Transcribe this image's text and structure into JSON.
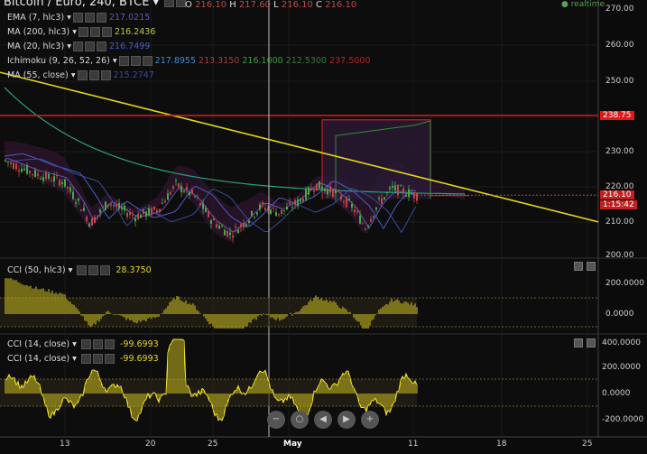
{
  "header": {
    "title": "Bitcoin / Euro, 240, BTCE",
    "ohlc": [
      {
        "k": "O",
        "v": "216.10"
      },
      {
        "k": "H",
        "v": "217.60"
      },
      {
        "k": "L",
        "v": "216.10"
      },
      {
        "k": "C",
        "v": "216.10"
      }
    ],
    "realtime": "realtime"
  },
  "legend": [
    {
      "name": "EMA (7, hlc3)",
      "values": [
        "217.0215"
      ],
      "colors": [
        "#6b4fb8"
      ]
    },
    {
      "name": "MA (200, hlc3)",
      "values": [
        "216.2436"
      ],
      "colors": [
        "#b8c84a"
      ]
    },
    {
      "name": "MA (20, hlc3)",
      "values": [
        "216.7499"
      ],
      "colors": [
        "#4a5cc8"
      ]
    },
    {
      "name": "Ichimoku (9, 26, 52, 26)",
      "values": [
        "217.8955",
        "213.3150",
        "216.1000",
        "212.5300",
        "237.5000"
      ],
      "colors": [
        "#3a8ae0",
        "#b03a3a",
        "#3aa03a",
        "#3a7a3a",
        "#c02020"
      ]
    },
    {
      "name": "MA (55, close)",
      "values": [
        "215.2747"
      ],
      "colors": [
        "#3a4a9a"
      ]
    }
  ],
  "price_axis": [
    "270.00",
    "260.00",
    "250.00",
    "240.00",
    "230.00",
    "220.00",
    "210.00",
    "200.00"
  ],
  "price_tags": {
    "horizontal": "238.75",
    "last": "216.10",
    "countdown": "1:15:42"
  },
  "cci1": {
    "label": "CCI (50, hlc3)",
    "value": "28.3750",
    "axis": [
      "200.0000",
      "0.0000"
    ]
  },
  "cci2": {
    "label1": "CCI (14, close)",
    "value1": "-99.6993",
    "label2": "CCI (14, close)",
    "value2": "-99.6993",
    "axis": [
      "400.0000",
      "200.0000",
      "0.0000",
      "-200.0000"
    ]
  },
  "time_axis": [
    "13",
    "20",
    "25",
    "May",
    "11",
    "18",
    "25"
  ],
  "nav_buttons": [
    "zoom-out-icon",
    "zoom-reset-icon",
    "scroll-left-icon",
    "scroll-right-icon"
  ],
  "colors": {
    "trendline": "#e6d81c",
    "hline": "#e01818",
    "cci": "#d8c820",
    "bull": "#4aa84a",
    "bear": "#c04848"
  }
}
